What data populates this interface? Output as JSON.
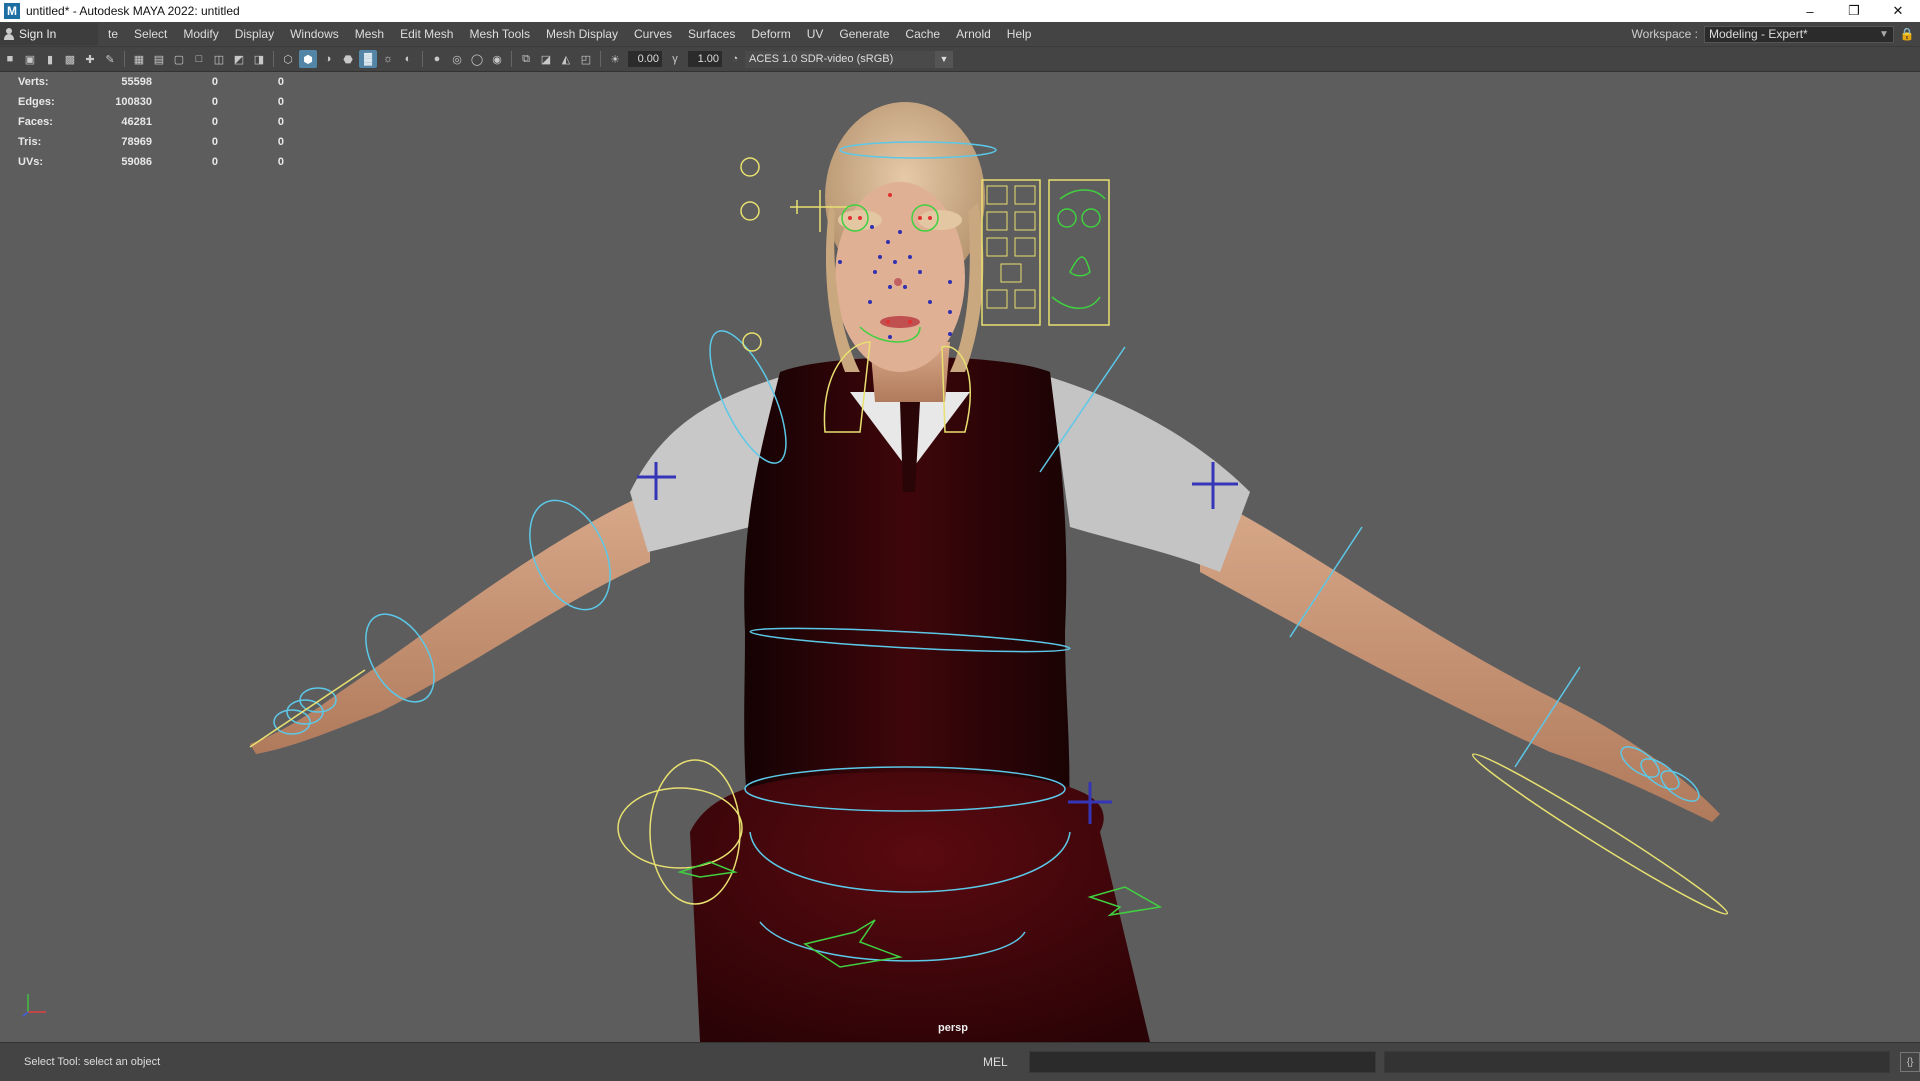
{
  "window": {
    "title": "untitled* - Autodesk MAYA 2022: untitled",
    "app_icon": "M",
    "controls": [
      "minimize-icon",
      "restore-icon",
      "close-icon"
    ]
  },
  "menubar": {
    "signin_label": "Sign In",
    "items": [
      "te",
      "Select",
      "Modify",
      "Display",
      "Windows",
      "Mesh",
      "Edit Mesh",
      "Mesh Tools",
      "Mesh Display",
      "Curves",
      "Surfaces",
      "Deform",
      "UV",
      "Generate",
      "Cache",
      "Arnold",
      "Help"
    ],
    "workspace_label": "Workspace :",
    "workspace_value": "Modeling - Expert*"
  },
  "panel_toolbar": {
    "exposure_value": "0.00",
    "gamma_value": "1.00",
    "color_space": "ACES 1.0 SDR-video (sRGB)"
  },
  "hud": {
    "rows": [
      {
        "label": "Verts:",
        "value": "55598",
        "sel": "0",
        "other": "0"
      },
      {
        "label": "Edges:",
        "value": "100830",
        "sel": "0",
        "other": "0"
      },
      {
        "label": "Faces:",
        "value": "46281",
        "sel": "0",
        "other": "0"
      },
      {
        "label": "Tris:",
        "value": "78969",
        "sel": "0",
        "other": "0"
      },
      {
        "label": "UVs:",
        "value": "59086",
        "sel": "0",
        "other": "0"
      }
    ]
  },
  "viewport": {
    "camera_label": "persp"
  },
  "statusbar": {
    "message": "Select Tool: select an object",
    "mel_label": "MEL"
  },
  "colors": {
    "viewport_bg": "#5d5d5d",
    "ui_bg": "#444444",
    "highlight": "#5285a6",
    "rig_cyan": "#5cc8e8",
    "rig_yellow": "#e8e070",
    "rig_green": "#40d040",
    "rig_blue": "#3030b0",
    "vest": "#3a0508"
  }
}
